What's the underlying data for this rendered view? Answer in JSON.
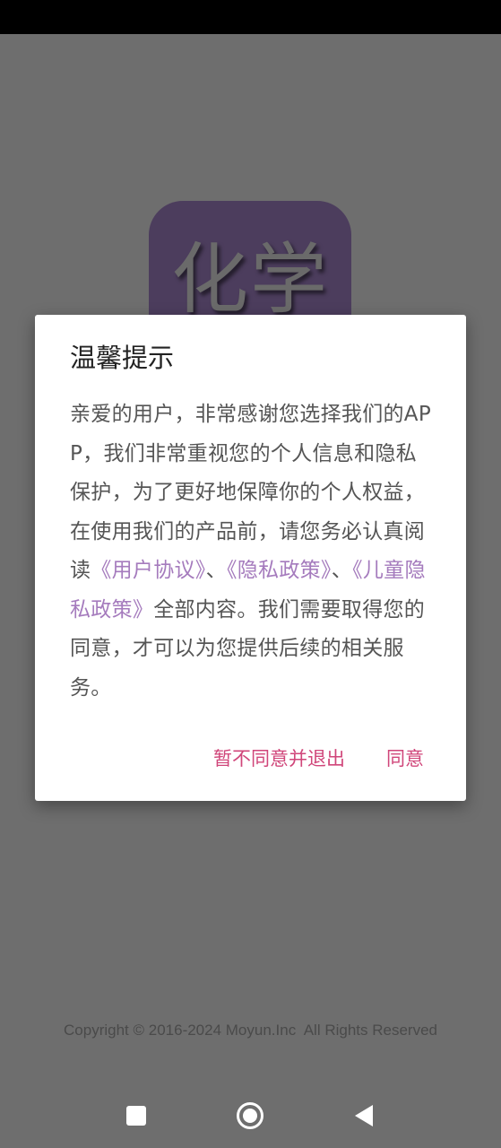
{
  "logo": {
    "text": "化学"
  },
  "dialog": {
    "title": "温馨提示",
    "body_intro": "亲爱的用户，非常感谢您选择我们的APP，我们非常重视您的个人信息和隐私保护，为了更好地保障你的个人权益，在使用我们的产品前，请您务必认真阅读",
    "link_user_agreement": "《用户协议》",
    "sep1": "、",
    "link_privacy_policy": "《隐私政策》",
    "sep2": "、",
    "link_child_privacy": "《儿童隐私政策》",
    "body_outro": "全部内容。我们需要取得您的同意，才可以为您提供后续的相关服务。",
    "decline_label": "暂不同意并退出",
    "agree_label": "同意"
  },
  "footer": {
    "copyright": "Copyright © 2016-2024 Moyun.Inc  All Rights Reserved"
  },
  "nav": {
    "recents_icon": "square-recents-icon",
    "home_icon": "circle-home-icon",
    "back_icon": "triangle-back-icon"
  },
  "colors": {
    "accent": "#d0467a",
    "link": "#a57bbd",
    "logo_bg": "#4c3d5d",
    "scrim": "#6e6e6e"
  }
}
